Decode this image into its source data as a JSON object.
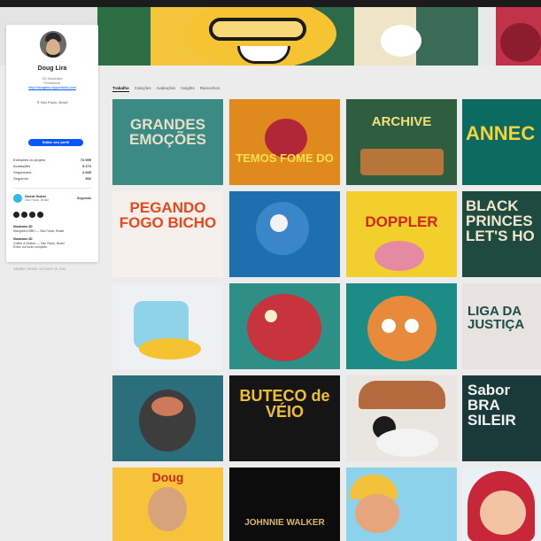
{
  "profile": {
    "name": "Doug Lira",
    "role": "2D Illustrator",
    "type": "Freelancer",
    "website": "http://douglira.myportfolio.com",
    "location": "São Paulo, Brazil",
    "follow_label": "Editar seu perfil",
    "stats": [
      {
        "label": "Exibições do projeto",
        "value": "72.595"
      },
      {
        "label": "Avaliações",
        "value": "9.173"
      },
      {
        "label": "Seguidores",
        "value": "2.945"
      },
      {
        "label": "Seguindo",
        "value": "932"
      }
    ],
    "owner": {
      "name": "Guest Guest",
      "location": "São Paulo, Brasil",
      "follow_label": "Seguindo"
    },
    "about": [
      {
        "title": "Illustrator 2D",
        "text": "Mangarino BBH — São Paulo, Brasil"
      },
      {
        "title": "Illustrator 2D",
        "text": "Coffee & Mother — São Paulo, Brasil",
        "extra": "Exibir currículo completo"
      }
    ],
    "member_since": "MEMBRO DESDE: OUTUBRO 18, 2016"
  },
  "tabs": [
    "Trabalho",
    "Coleções",
    "Avaliações",
    "Insights",
    "Rascunhos"
  ],
  "tiles": [
    {
      "text": "GRANDES EMOÇÕES",
      "bg": "#3b8a84",
      "fg": "#e6e0c8"
    },
    {
      "text": "TEMOS FOME DO",
      "bg": "#e08a1e",
      "fg": "#f7e04a"
    },
    {
      "text": "ARCHIVE",
      "bg": "#2e5d3f",
      "fg": "#f4e07a"
    },
    {
      "text": "ANNEC",
      "bg": "#0b6b60",
      "fg": "#f7d23a"
    },
    {
      "text": "PEGANDO FOGO BICHO",
      "bg": "#f5f0ec",
      "fg": "#e8481c"
    },
    {
      "text": "",
      "bg": "#1e6fae",
      "fg": "#ffffff"
    },
    {
      "text": "DOPPLER",
      "bg": "#f3cf2e",
      "fg": "#d2271f"
    },
    {
      "text": "BLACK PRINCES LET'S HO",
      "bg": "#1e4a3f",
      "fg": "#f0e6cc"
    },
    {
      "text": "",
      "bg": "#eef0f3",
      "fg": "#2a2a2a"
    },
    {
      "text": "",
      "bg": "#2d8f86",
      "fg": "#c8343e"
    },
    {
      "text": "",
      "bg": "#1c8c86",
      "fg": "#e88a3c"
    },
    {
      "text": "LIGA DA JUSTIÇA",
      "bg": "#e8e3e1",
      "fg": "#1b4f46"
    },
    {
      "text": "",
      "bg": "#2b6e7c",
      "fg": "#2a2a2a"
    },
    {
      "text": "BUTECO de VÉIO",
      "bg": "#151515",
      "fg": "#f0c032"
    },
    {
      "text": "",
      "bg": "#e9e6e2",
      "fg": "#d3483a"
    },
    {
      "text": "Sabor BRA SILEIR",
      "bg": "#1a3a39",
      "fg": "#f2f2f2"
    },
    {
      "text": "Doug",
      "bg": "#f6c33a",
      "fg": "#d2271f"
    },
    {
      "text": "JOHNNIE WALKER",
      "bg": "#0c0c0c",
      "fg": "#d9b76a"
    },
    {
      "text": "",
      "bg": "#8bd2ea",
      "fg": "#f3c13a"
    },
    {
      "text": "",
      "bg": "#e9f1f4",
      "fg": "#c8273a"
    }
  ]
}
